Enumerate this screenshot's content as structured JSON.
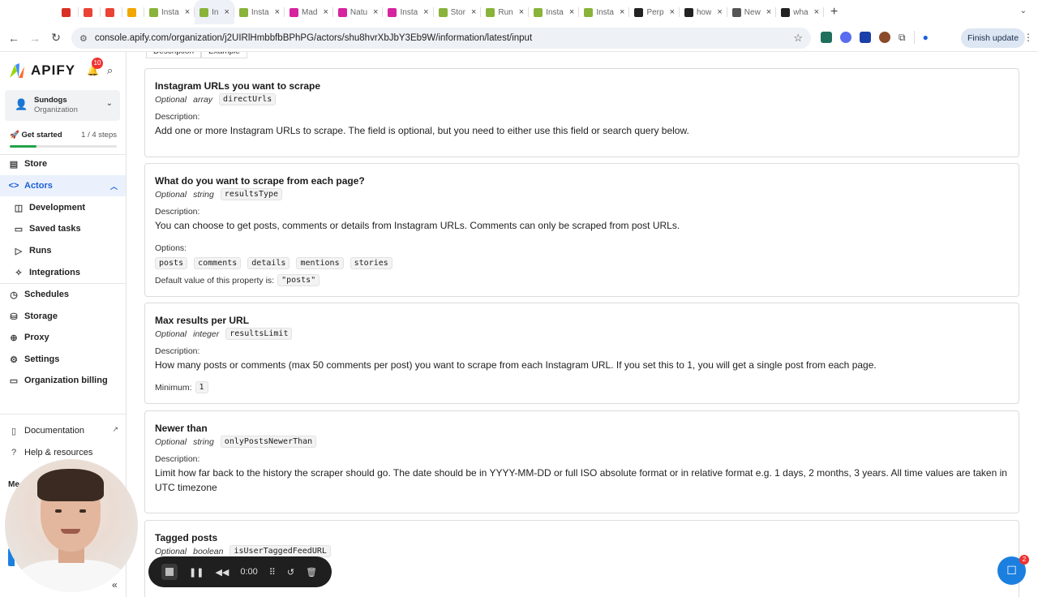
{
  "browser": {
    "tabs": [
      {
        "title": "",
        "color": "#d93025"
      },
      {
        "title": "",
        "color": "#ea4335"
      },
      {
        "title": "",
        "color": "#ea4335"
      },
      {
        "title": "",
        "color": "#f2a600"
      },
      {
        "title": "Insta",
        "color": "#8ab33a"
      },
      {
        "title": "In",
        "color": "#8ab33a",
        "active": true
      },
      {
        "title": "Insta",
        "color": "#8ab33a"
      },
      {
        "title": "Mad",
        "color": "#d6249f"
      },
      {
        "title": "Natu",
        "color": "#d6249f"
      },
      {
        "title": "Insta",
        "color": "#d6249f"
      },
      {
        "title": "Stor",
        "color": "#8ab33a"
      },
      {
        "title": "Run",
        "color": "#8ab33a"
      },
      {
        "title": "Insta",
        "color": "#8ab33a"
      },
      {
        "title": "Insta",
        "color": "#8ab33a"
      },
      {
        "title": "Perp",
        "color": "#222222"
      },
      {
        "title": "how",
        "color": "#222222"
      },
      {
        "title": "New",
        "color": "#555555"
      },
      {
        "title": "wha",
        "color": "#222222"
      }
    ],
    "url": "console.apify.com/organization/j2UIRlHmbbfbBPhPG/actors/shu8hvrXbJbY3Eb9W/information/latest/input",
    "finish_update_label": "Finish update"
  },
  "sidebar": {
    "logo_text": "APIFY",
    "notification_count": "10",
    "org_name": "Sundogs",
    "org_type": "Organization",
    "get_started_label": "🚀 Get started",
    "steps_label": "1 / 4 steps",
    "progress_fraction": 0.25,
    "items": [
      {
        "label": "Store",
        "icon": "store-icon"
      },
      {
        "label": "Actors",
        "icon": "code-icon"
      },
      {
        "label": "Development",
        "icon": "development-icon"
      },
      {
        "label": "Saved tasks",
        "icon": "saved-tasks-icon"
      },
      {
        "label": "Runs",
        "icon": "play-icon"
      },
      {
        "label": "Integrations",
        "icon": "integrations-icon"
      },
      {
        "label": "Schedules",
        "icon": "clock-icon"
      },
      {
        "label": "Storage",
        "icon": "database-icon"
      },
      {
        "label": "Proxy",
        "icon": "globe-icon"
      },
      {
        "label": "Settings",
        "icon": "gear-icon"
      },
      {
        "label": "Organization billing",
        "icon": "billing-icon"
      },
      {
        "label": "Documentation",
        "icon": "book-icon"
      },
      {
        "label": "Help & resources",
        "icon": "help-icon"
      }
    ],
    "footer_partial_label": "Me"
  },
  "main": {
    "top_tabs": [
      "Description",
      "Example"
    ],
    "labels": {
      "optional": "Optional",
      "description": "Description:",
      "options": "Options:",
      "default_value": "Default value of this property is:",
      "minimum": "Minimum:"
    },
    "fields": [
      {
        "title": "Instagram URLs you want to scrape",
        "type": "array",
        "key": "directUrls",
        "description": "Add one or more Instagram URLs to scrape. The field is optional, but you need to either use this field or search query below."
      },
      {
        "title": "What do you want to scrape from each page?",
        "type": "string",
        "key": "resultsType",
        "description": "You can choose to get posts, comments or details from Instagram URLs. Comments can only be scraped from post URLs.",
        "options": [
          "posts",
          "comments",
          "details",
          "mentions",
          "stories"
        ],
        "default": "\"posts\""
      },
      {
        "title": "Max results per URL",
        "type": "integer",
        "key": "resultsLimit",
        "description": "How many posts or comments (max 50 comments per post) you want to scrape from each Instagram URL. If you set this to 1, you will get a single post from each page.",
        "minimum": "1"
      },
      {
        "title": "Newer than",
        "type": "string",
        "key": "onlyPostsNewerThan",
        "description": "Limit how far back to the history the scraper should go. The date should be in YYYY-MM-DD or full ISO absolute format or in relative format e.g. 1 days, 2 months, 3 years. All time values are taken in UTC timezone"
      },
      {
        "title": "Tagged posts",
        "type": "boolean",
        "key": "isUserTaggedFeedURL"
      }
    ]
  },
  "recorder": {
    "time": "0:00"
  },
  "chat": {
    "badge": "2"
  }
}
